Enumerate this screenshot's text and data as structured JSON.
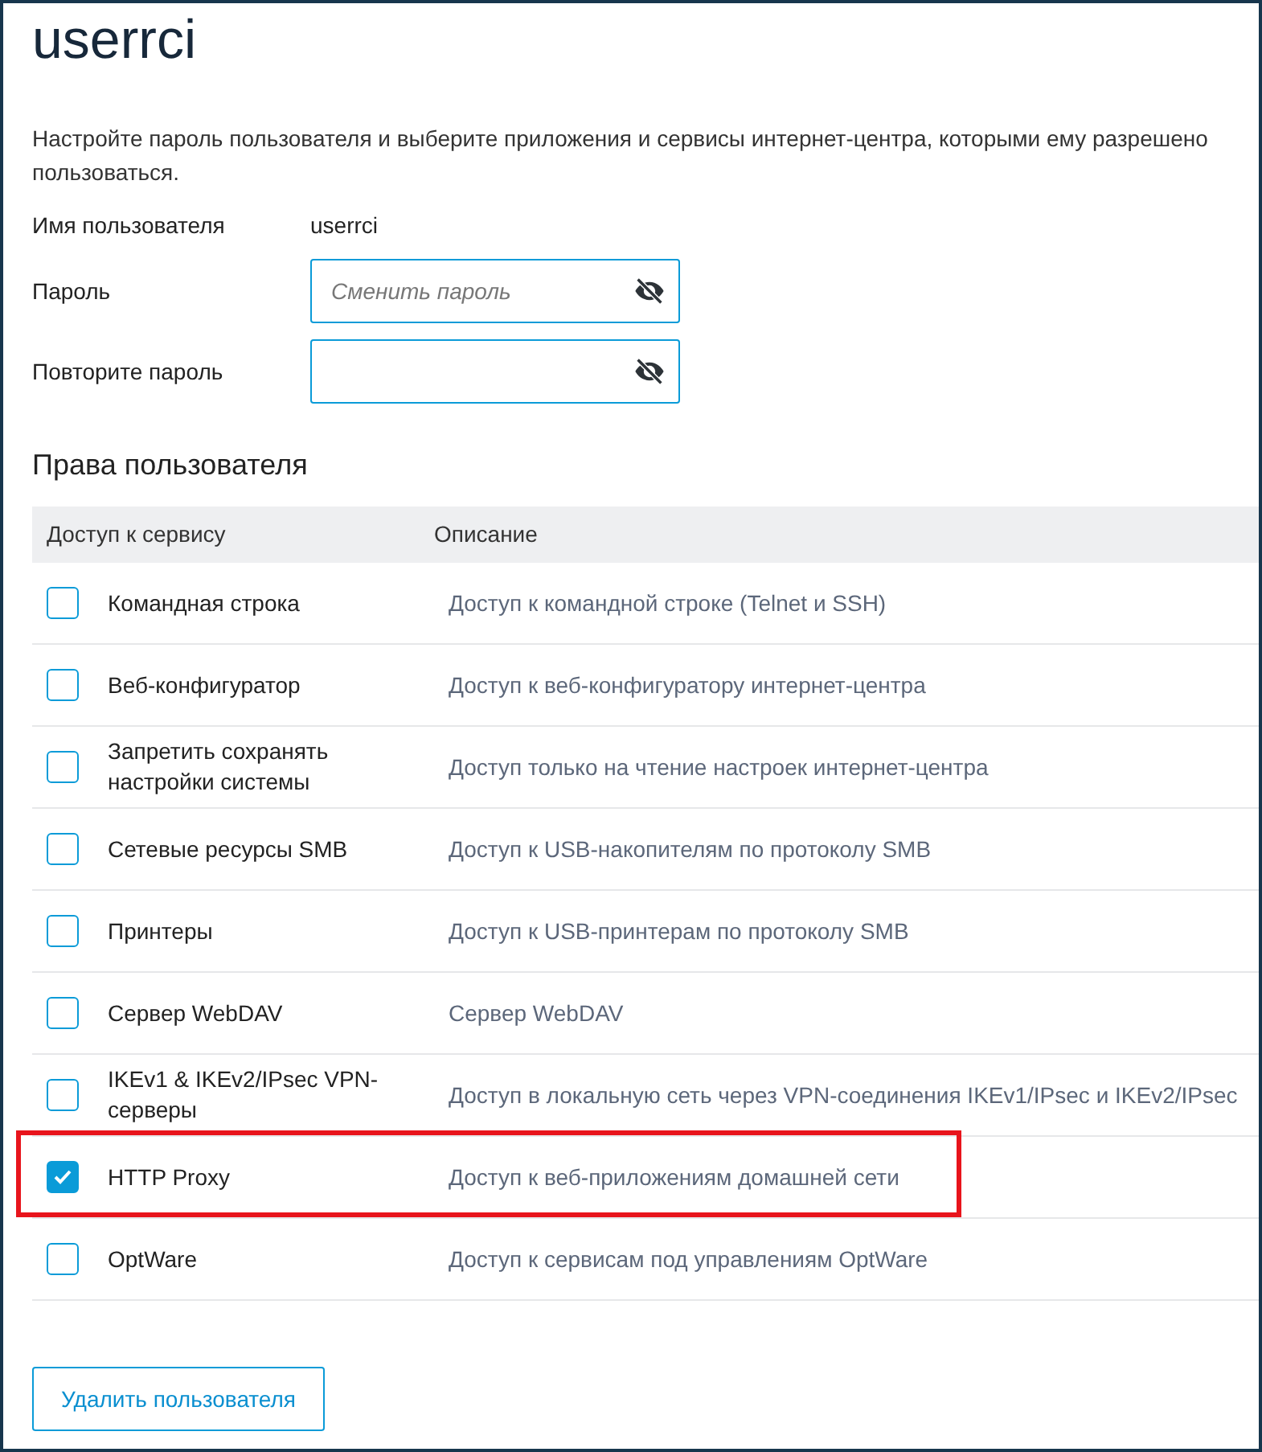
{
  "title": "userrci",
  "intro": "Настройте пароль пользователя и выберите приложения и сервисы интернет-центра, которыми ему разрешено пользоваться.",
  "username": {
    "label": "Имя пользователя",
    "value": "userrci"
  },
  "password_fields": [
    {
      "label": "Пароль",
      "placeholder": "Сменить пароль"
    },
    {
      "label": "Повторите пароль"
    }
  ],
  "permissions": {
    "heading": "Права пользователя",
    "columns": [
      "Доступ к сервису",
      "Описание"
    ],
    "rows": [
      {
        "name": "Командная строка",
        "description": "Доступ к командной строке (Telnet и SSH)",
        "checked": false,
        "highlighted": false
      },
      {
        "name": "Веб-конфигуратор",
        "description": "Доступ к веб-конфигуратору интернет-центра",
        "checked": false,
        "highlighted": false
      },
      {
        "name": "Запретить сохранять настройки системы",
        "description": "Доступ только на чтение настроек интернет-центра",
        "checked": false,
        "highlighted": false
      },
      {
        "name": "Сетевые ресурсы SMB",
        "description": "Доступ к USB-накопителям по протоколу SMB",
        "checked": false,
        "highlighted": false
      },
      {
        "name": "Принтеры",
        "description": "Доступ к USB-принтерам по протоколу SMB",
        "checked": false,
        "highlighted": false
      },
      {
        "name": "Сервер WebDAV",
        "description": "Сервер WebDAV",
        "checked": false,
        "highlighted": false
      },
      {
        "name": "IKEv1 & IKEv2/IPsec VPN-серверы",
        "description": "Доступ в локальную сеть через VPN-соединения IKEv1/IPsec и IKEv2/IPsec",
        "checked": false,
        "highlighted": false
      },
      {
        "name": "HTTP Proxy",
        "description": "Доступ к веб-приложениям домашней сети",
        "checked": true,
        "highlighted": true
      },
      {
        "name": "OptWare",
        "description": "Доступ к сервисам под управлениям OptWare",
        "checked": false,
        "highlighted": false
      }
    ]
  },
  "delete_button": "Удалить пользователя"
}
